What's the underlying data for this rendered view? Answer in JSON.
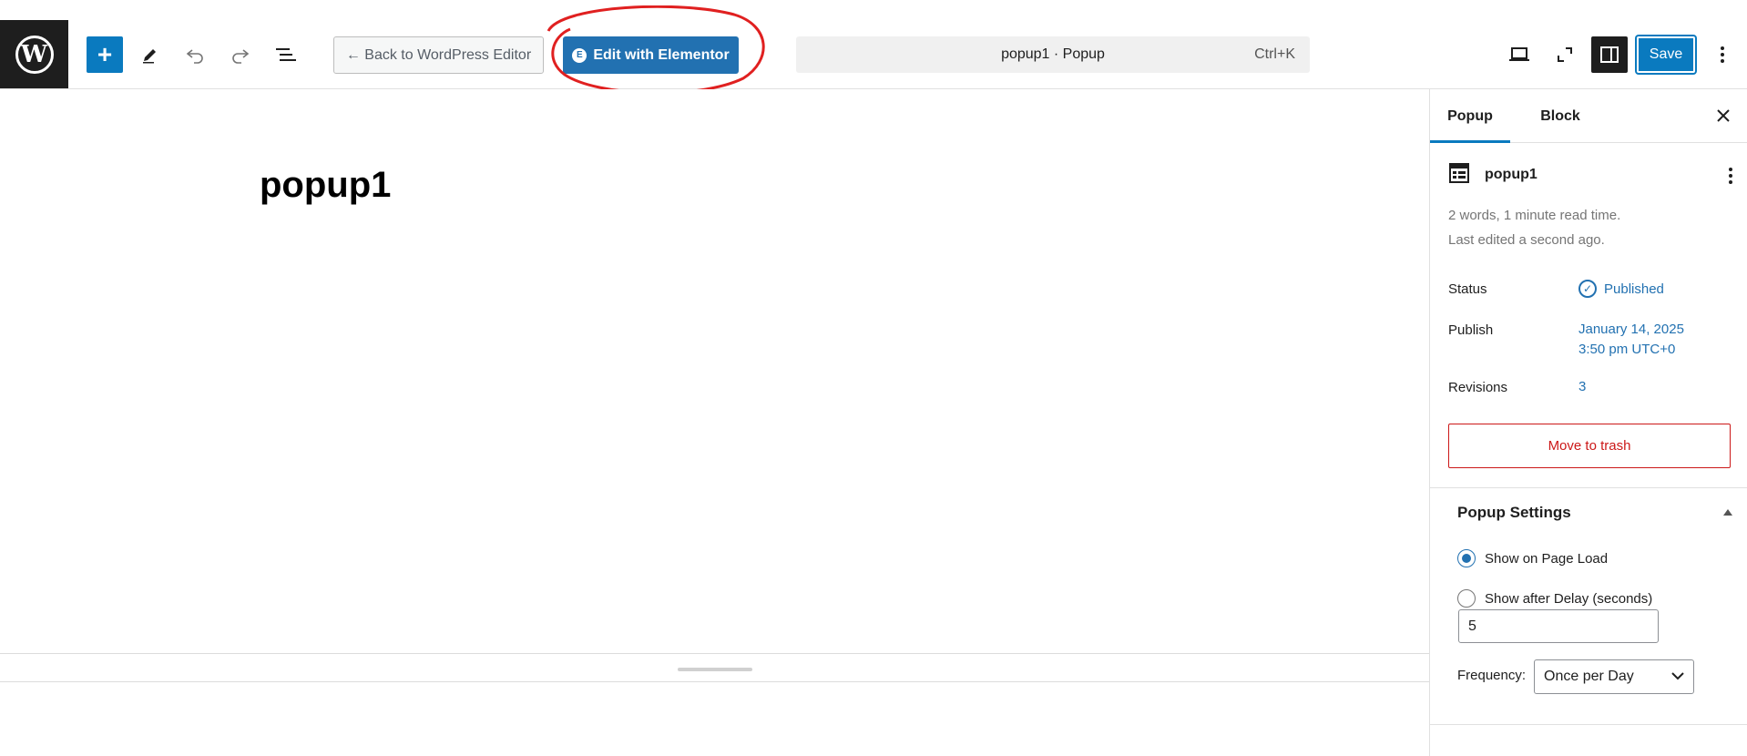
{
  "toolbar": {
    "logo_letter": "W",
    "add_glyph": "+",
    "back_label": "← Back to WordPress Editor",
    "elementor_badge": "E",
    "elementor_label": "Edit with Elementor",
    "command_bar_title": "popup1 · Popup",
    "command_bar_shortcut": "Ctrl+K",
    "save_label": "Save",
    "icons": [
      "wordpress-logo",
      "plus",
      "pencil",
      "undo",
      "redo",
      "document-outline",
      "laptop",
      "fullscreen",
      "sidebar-toggle",
      "kebab-menu"
    ]
  },
  "canvas": {
    "title": "popup1"
  },
  "sidebar": {
    "tabs": [
      {
        "label": "Popup",
        "active": true
      },
      {
        "label": "Block",
        "active": false
      }
    ],
    "post": {
      "name": "popup1",
      "word_count_info": "2 words, 1 minute read time.",
      "last_edited": "Last edited a second ago."
    },
    "status": {
      "label": "Status",
      "value": "Published"
    },
    "publish": {
      "label": "Publish",
      "date": "January 14, 2025",
      "time": "3:50 pm UTC+0"
    },
    "revisions": {
      "label": "Revisions",
      "value": "3"
    },
    "trash_label": "Move to trash",
    "popup_settings": {
      "title": "Popup Settings",
      "options": [
        {
          "label": "Show on Page Load",
          "selected": true
        },
        {
          "label": "Show after Delay (seconds)",
          "selected": false
        }
      ],
      "delay_value": "5",
      "frequency_label": "Frequency:",
      "frequency_value": "Once per Day"
    }
  },
  "colors": {
    "accent": "#0a7abf",
    "elementor_button": "#2271b1",
    "link": "#2271b1",
    "danger": "#cc1818",
    "annotation": "#e02020"
  }
}
